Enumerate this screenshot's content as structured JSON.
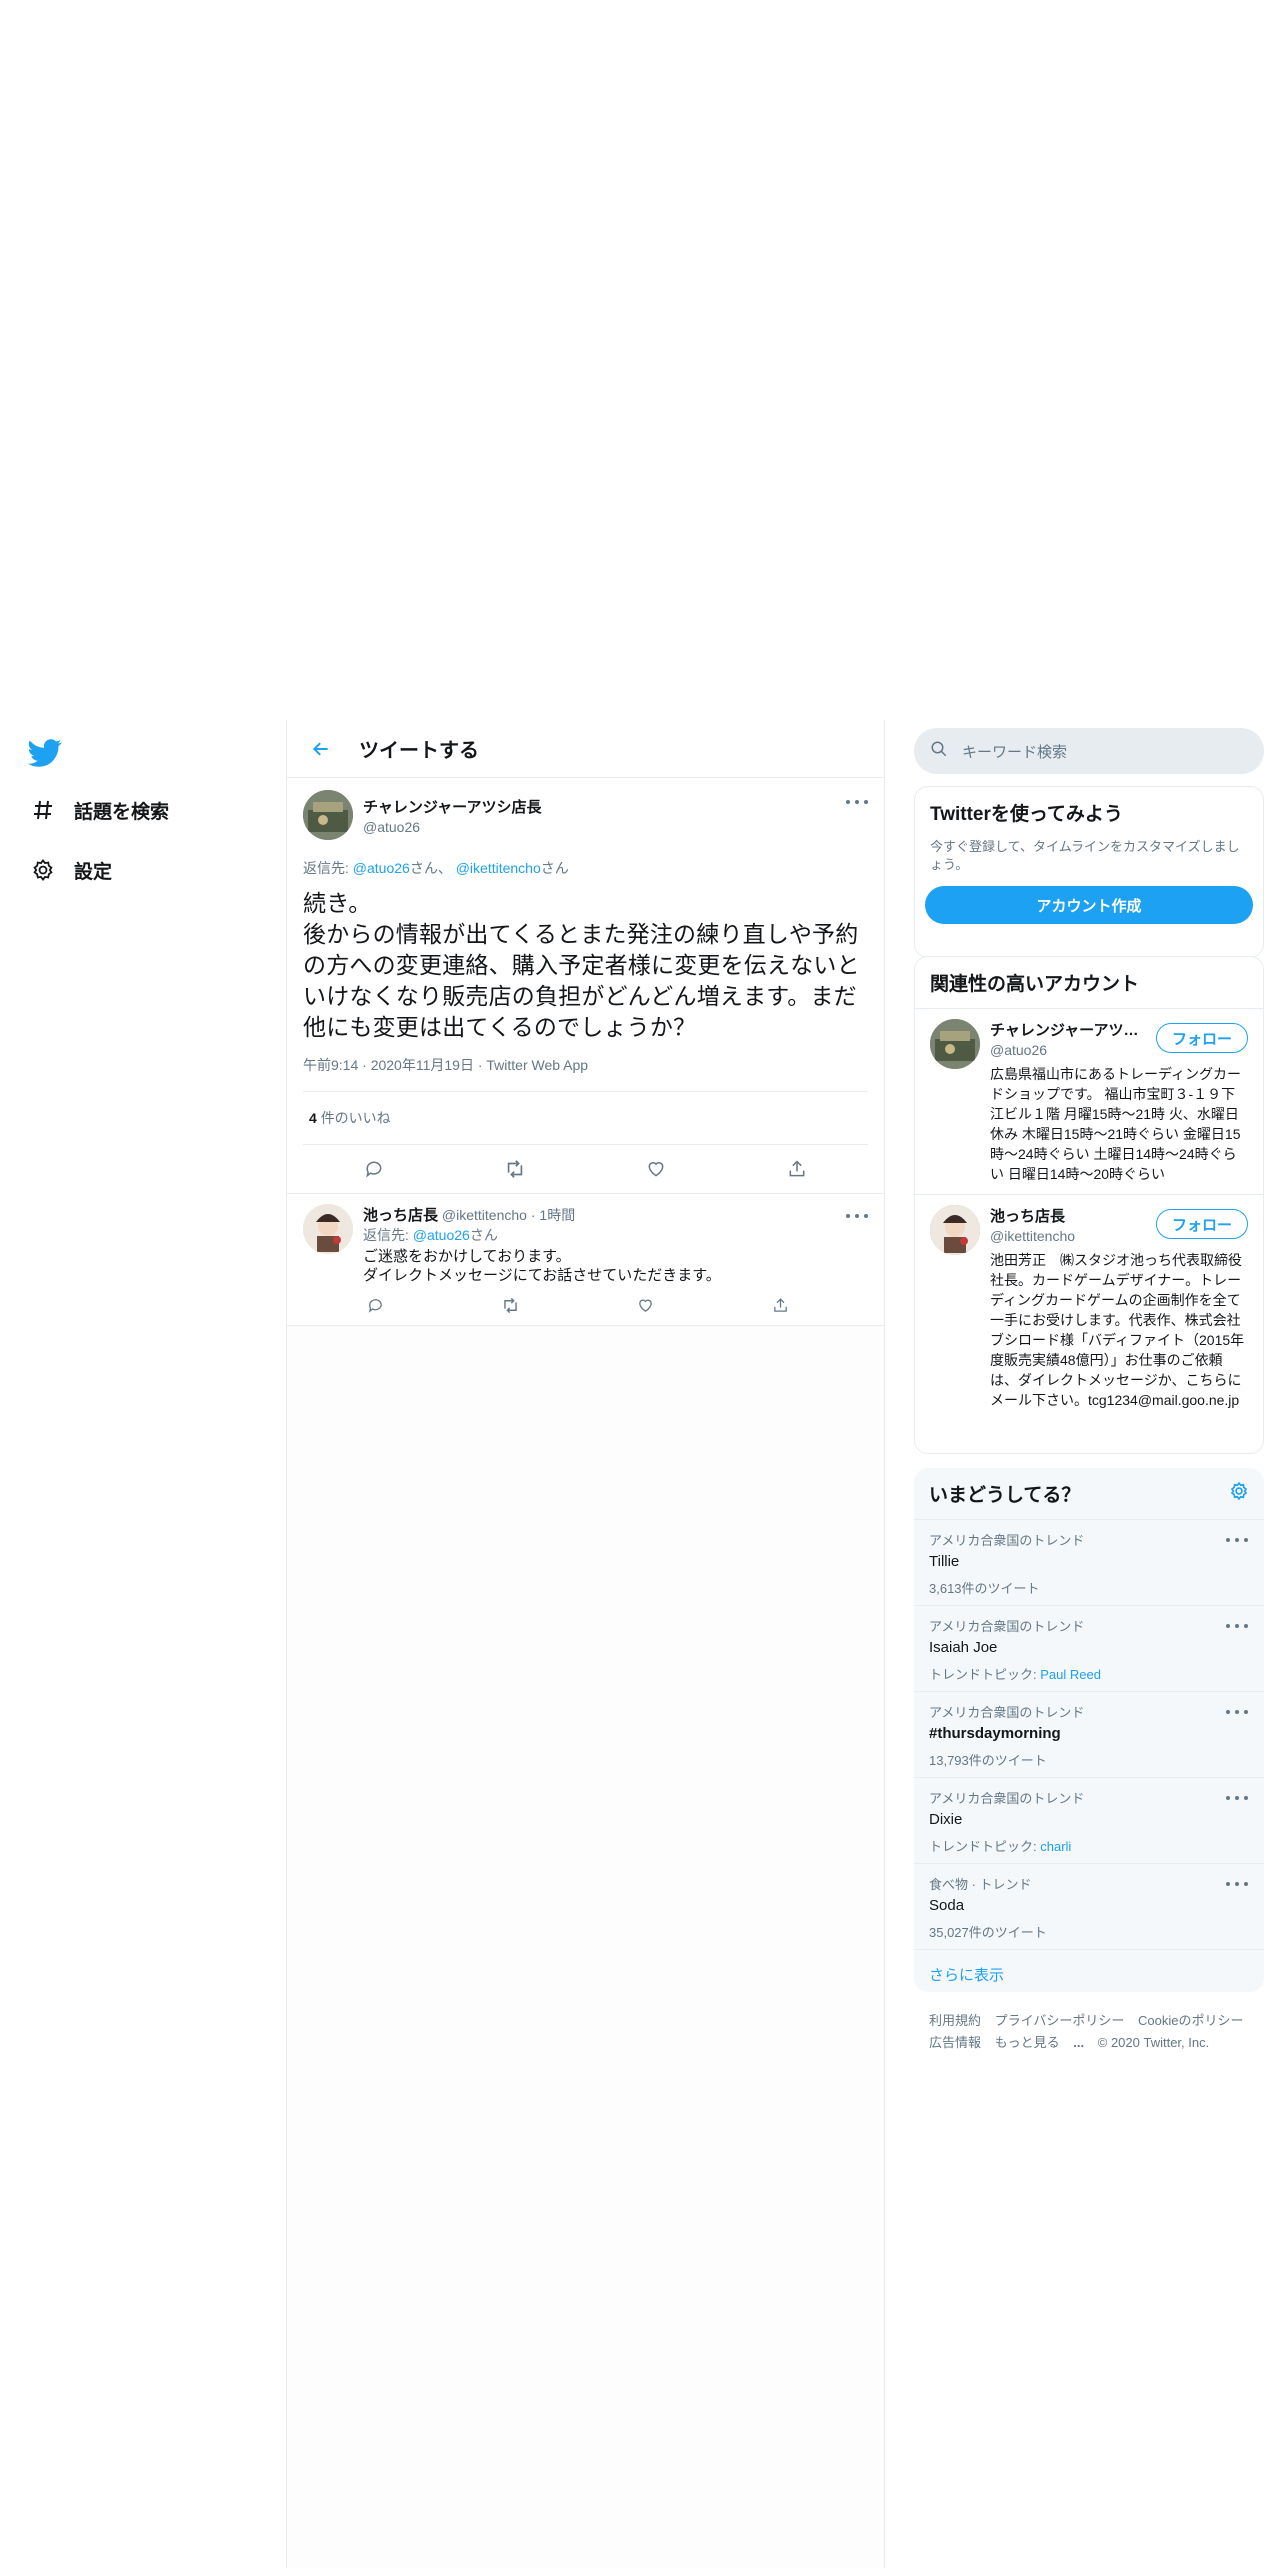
{
  "nav": {
    "explore_label": "話題を検索",
    "settings_label": "設定"
  },
  "main": {
    "header_title": "ツイートする",
    "tweet": {
      "name": "チャレンジャーアツシ店長",
      "handle": "@atuo26",
      "reply_prefix": "返信先:",
      "reply_user1": "@atuo26",
      "reply_mid": "さん、",
      "reply_user2": "@ikettitencho",
      "reply_suffix": "さん",
      "text_line1": "続き。",
      "text_line2": "後からの情報が出てくるとまた発注の練り直しや予約の方への変更連絡、購入予定者様に変更を伝えないといけなくなり販売店の負担がどんどん増えます。まだ他にも変更は出てくるのでしょうか？",
      "time": "午前9:14",
      "date": "2020年11月19日",
      "source": "Twitter Web App",
      "likes_count": "4",
      "likes_label": "件のいいね"
    },
    "reply": {
      "name": "池っち店長",
      "handle": "@ikettitencho",
      "time": "1時間",
      "reply_prefix": "返信先:",
      "reply_user": "@atuo26",
      "reply_suffix": "さん",
      "text_line1": "ご迷惑をおかけしております。",
      "text_line2": "ダイレクトメッセージにてお話させていただきます。"
    }
  },
  "right": {
    "search_placeholder": "キーワード検索",
    "signup": {
      "title": "Twitterを使ってみよう",
      "subtitle": "今すぐ登録して、タイムラインをカスタマイズしましょう。",
      "button": "アカウント作成"
    },
    "relevant": {
      "title": "関連性の高いアカウント",
      "follow_label": "フォロー",
      "accounts": [
        {
          "name": "チャレンジャーアツシ店長",
          "handle": "@atuo26",
          "bio": "広島県福山市にあるトレーディングカードショップです。 福山市宝町３-１９下江ビル１階 月曜15時～21時 火、水曜日休み 木曜日15時～21時ぐらい 金曜日15時～24時ぐらい 土曜日14時～24時ぐらい 日曜日14時～20時ぐらい"
        },
        {
          "name": "池っち店長",
          "handle": "@ikettitencho",
          "bio": "池田芳正　㈱スタジオ池っち代表取締役社長。カードゲームデザイナー。トレーディングカードゲームの企画制作を全て一手にお受けします。代表作、株式会社ブシロード様「バディファイト（2015年度販売実績48億円）」お仕事のご依頼は、ダイレクトメッセージか、こちらにメール下さい。tcg1234@mail.goo.ne.jp"
        }
      ]
    },
    "trends": {
      "title": "いまどうしてる？",
      "items": [
        {
          "context": "アメリカ合衆国のトレンド",
          "name": "Tillie",
          "meta": "3,613件のツイート",
          "meta_link": ""
        },
        {
          "context": "アメリカ合衆国のトレンド",
          "name": "Isaiah Joe",
          "meta": "トレンドトピック: ",
          "meta_link": "Paul Reed"
        },
        {
          "context": "アメリカ合衆国のトレンド",
          "name": "#thursdaymorning",
          "meta": "13,793件のツイート",
          "meta_link": ""
        },
        {
          "context": "アメリカ合衆国のトレンド",
          "name": "Dixie",
          "meta": "トレンドトピック: ",
          "meta_link": "charli"
        },
        {
          "context": "食べ物 · トレンド",
          "name": "Soda",
          "meta": "35,027件のツイート",
          "meta_link": ""
        }
      ],
      "show_more": "さらに表示"
    },
    "footer": {
      "terms": "利用規約",
      "privacy": "プライバシーポリシー",
      "cookie": "Cookieのポリシー",
      "ads": "広告情報",
      "more": "もっと見る",
      "copyright": "© 2020 Twitter, Inc."
    }
  }
}
